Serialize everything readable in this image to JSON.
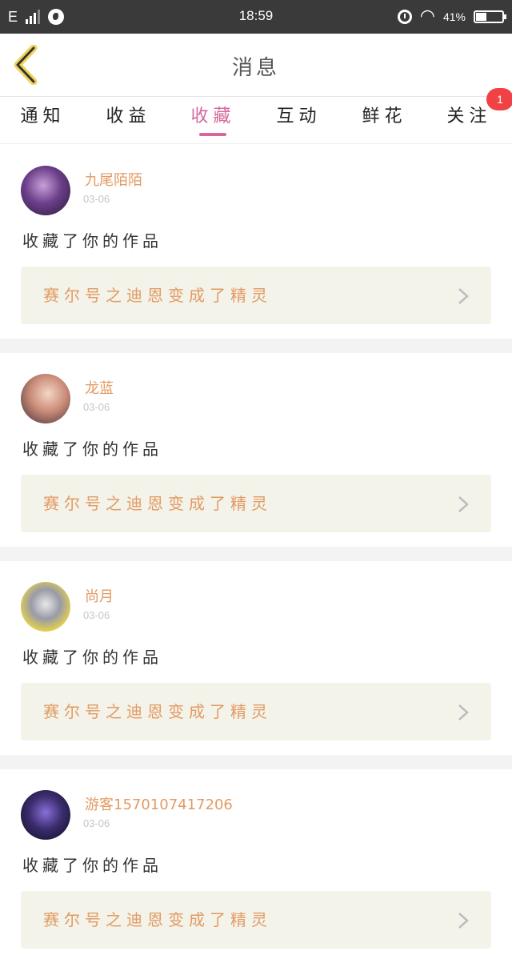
{
  "status_bar": {
    "network": "E",
    "time": "18:59",
    "battery_percent": "41%",
    "battery_level": 0.41
  },
  "header": {
    "title": "消息"
  },
  "tabs": [
    {
      "label": "通知",
      "active": false
    },
    {
      "label": "收益",
      "active": false
    },
    {
      "label": "收藏",
      "active": true
    },
    {
      "label": "互动",
      "active": false
    },
    {
      "label": "鲜花",
      "active": false
    },
    {
      "label": "关注",
      "active": false
    }
  ],
  "follow_badge": "1",
  "messages": [
    {
      "user": "九尾陌陌",
      "date": "03-06",
      "action": "收藏了你的作品",
      "work_title": "赛尔号之迪恩变成了精灵"
    },
    {
      "user": "龙蓝",
      "date": "03-06",
      "action": "收藏了你的作品",
      "work_title": "赛尔号之迪恩变成了精灵"
    },
    {
      "user": "尚月",
      "date": "03-06",
      "action": "收藏了你的作品",
      "work_title": "赛尔号之迪恩变成了精灵"
    },
    {
      "user": "游客1570107417206",
      "date": "03-06",
      "action": "收藏了你的作品",
      "work_title": "赛尔号之迪恩变成了精灵"
    }
  ],
  "colors": {
    "accent": "#d6679c",
    "name": "#e39a63",
    "work_bg": "#f3f3ea",
    "badge": "#f04144"
  }
}
